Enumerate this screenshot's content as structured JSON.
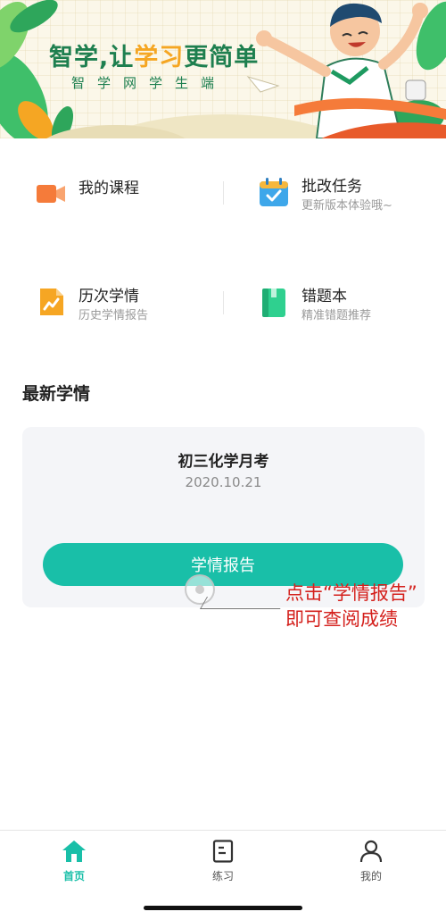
{
  "banner": {
    "title_part1": "智学,让",
    "title_accent": "学习",
    "title_part2": "更简单",
    "subtitle": "智学网学生端"
  },
  "menu": [
    {
      "title": "我的课程",
      "subtitle": "",
      "icon": "video-camera-icon",
      "color": "#f57b3a"
    },
    {
      "title": "批改任务",
      "subtitle": "更新版本体验哦~",
      "icon": "calendar-check-icon",
      "color": "#3ea7ea"
    },
    {
      "title": "历次学情",
      "subtitle": "历史学情报告",
      "icon": "trend-chart-icon",
      "color": "#f6a623"
    },
    {
      "title": "错题本",
      "subtitle": "精准错题推荐",
      "icon": "notebook-icon",
      "color": "#2fd08f"
    }
  ],
  "latest": {
    "section_title": "最新学情",
    "exam_name": "初三化学月考",
    "exam_date": "2020.10.21",
    "button_label": "学情报告"
  },
  "hint": {
    "line1": "点击“学情报告”",
    "line2": "即可查阅成绩"
  },
  "tabbar": {
    "items": [
      {
        "label": "首页",
        "icon": "home-icon",
        "active": true
      },
      {
        "label": "练习",
        "icon": "document-icon",
        "active": false
      },
      {
        "label": "我的",
        "icon": "person-icon",
        "active": false
      }
    ]
  },
  "colors": {
    "accent": "#19bfa8",
    "brand_green": "#1e7f4f",
    "hint_red": "#d4201c"
  }
}
